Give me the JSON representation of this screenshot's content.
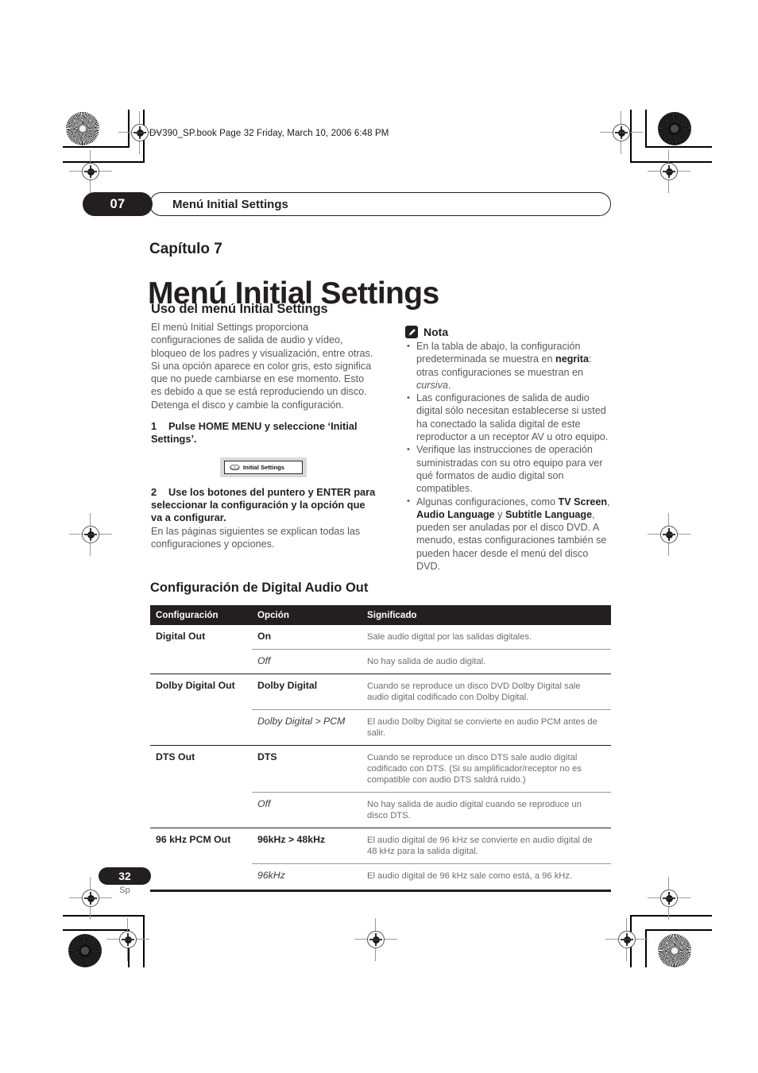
{
  "header": {
    "file_line": "DV390_SP.book  Page 32  Friday, March 10, 2006  6:48 PM"
  },
  "chapter_bar": {
    "number": "07",
    "title": "Menú Initial Settings"
  },
  "title_block": {
    "chapter_label": "Capítulo 7",
    "chapter_title": "Menú Initial Settings"
  },
  "left_column": {
    "section_heading": "Uso del menú Initial Settings",
    "intro_paragraph_1": "El menú Initial Settings proporciona configuraciones de salida de audio y vídeo, bloqueo de los padres y visualización, entre otras.",
    "intro_paragraph_2": "Si una opción aparece en color gris, esto significa que no puede cambiarse en ese momento. Esto es debido a que se está reproduciendo un disco. Detenga el disco y cambie la configuración.",
    "step1_number": "1",
    "step1_text": "Pulse HOME MENU y seleccione ‘Initial Settings’.",
    "osd_button_label": "Initial Settings",
    "osd_button_icon": "disc-icon",
    "step2_number": "2",
    "step2_text": "Use los botones del puntero y ENTER para seleccionar la configuración y la opción que va a configurar.",
    "step2_note": "En las páginas siguientes se explican todas las configuraciones y opciones."
  },
  "right_column": {
    "nota_icon": "pencil-note-icon",
    "nota_label": "Nota",
    "notes": [
      {
        "segments": [
          {
            "text": "En la tabla de abajo, la configuración predeterminada se muestra en ",
            "style": "normal"
          },
          {
            "text": "negrita",
            "style": "bold"
          },
          {
            "text": ": otras configuraciones se muestran en ",
            "style": "normal"
          },
          {
            "text": "cursiva",
            "style": "italic"
          },
          {
            "text": ".",
            "style": "normal"
          }
        ]
      },
      {
        "segments": [
          {
            "text": "Las configuraciones de salida de audio digital sólo necesitan establecerse si usted ha conectado la salida digital de este reproductor a un receptor AV u otro equipo.",
            "style": "normal"
          }
        ]
      },
      {
        "segments": [
          {
            "text": "Verifique las instrucciones de operación suministradas con su otro equipo para ver qué formatos de audio digital son compatibles.",
            "style": "normal"
          }
        ]
      },
      {
        "segments": [
          {
            "text": "Algunas configuraciones, como ",
            "style": "normal"
          },
          {
            "text": "TV Screen",
            "style": "bold"
          },
          {
            "text": ", ",
            "style": "normal"
          },
          {
            "text": "Audio Language",
            "style": "bold"
          },
          {
            "text": " y ",
            "style": "normal"
          },
          {
            "text": "Subtitle Language",
            "style": "bold"
          },
          {
            "text": ", pueden ser anuladas por el disco DVD. A menudo, estas configuraciones también se pueden hacer desde el menú del disco DVD.",
            "style": "normal"
          }
        ]
      }
    ]
  },
  "table_section": {
    "title": "Configuración de Digital Audio Out",
    "columns": [
      "Configuración",
      "Opción",
      "Significado"
    ],
    "rows": [
      {
        "setting": "Digital Out",
        "option": "On",
        "option_style": "bold",
        "meaning": "Sale audio digital por las salidas digitales.",
        "group_start": true
      },
      {
        "setting": "",
        "option": "Off",
        "option_style": "italic",
        "meaning": "No hay salida de audio digital.",
        "group_start": false
      },
      {
        "setting": "Dolby Digital Out",
        "option": "Dolby Digital",
        "option_style": "bold",
        "meaning": "Cuando se reproduce un disco DVD Dolby Digital sale audio digital codificado con Dolby Digital.",
        "group_start": true
      },
      {
        "setting": "",
        "option": "Dolby Digital > PCM",
        "option_style": "italic",
        "meaning": "El audio Dolby Digital se convierte en audio PCM antes de salir.",
        "group_start": false
      },
      {
        "setting": "DTS Out",
        "option": "DTS",
        "option_style": "bold",
        "meaning": "Cuando se reproduce un disco DTS sale audio digital codificado con DTS. (Si su amplificador/receptor no es compatible con audio DTS saldrá ruido.)",
        "group_start": true
      },
      {
        "setting": "",
        "option": "Off",
        "option_style": "italic",
        "meaning": "No hay salida de audio digital cuando se reproduce un disco DTS.",
        "group_start": false
      },
      {
        "setting": "96 kHz PCM Out",
        "option": "96kHz > 48kHz",
        "option_style": "bold",
        "meaning": "El audio digital de 96 kHz se convierte en audio digital de 48 kHz para la salida digital.",
        "group_start": true
      },
      {
        "setting": "",
        "option": "96kHz",
        "option_style": "italic",
        "meaning": "El audio digital de 96 kHz sale como está, a 96 kHz.",
        "group_start": false
      }
    ]
  },
  "footer": {
    "page_number": "32",
    "language_code": "Sp"
  },
  "colors": {
    "ink": "#231f20",
    "body_gray": "#58595b",
    "table_gray": "#6d6e71",
    "header_bar": "#231f20"
  }
}
